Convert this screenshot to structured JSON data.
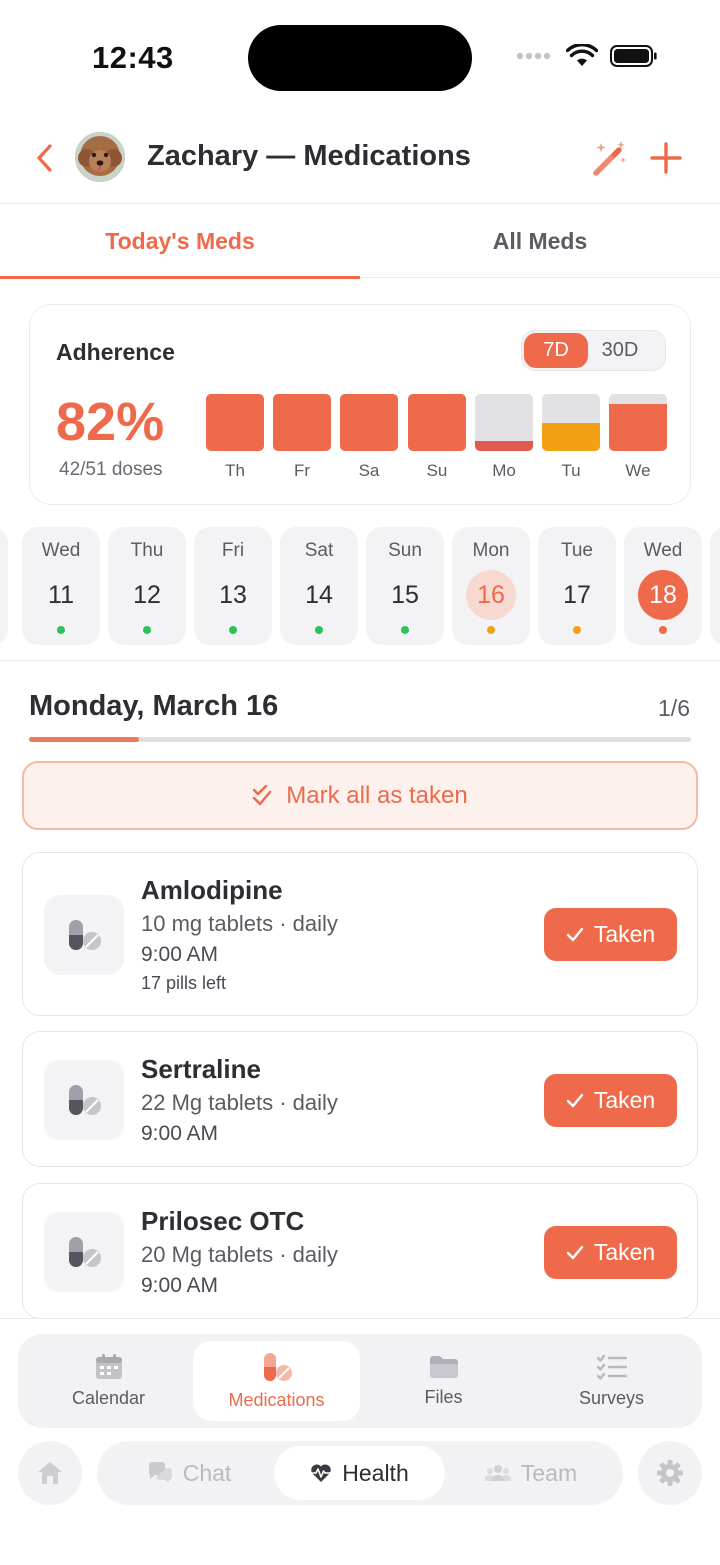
{
  "status_bar": {
    "time": "12:43"
  },
  "header": {
    "title": "Zachary — Medications"
  },
  "tabs": [
    {
      "label": "Today's Meds",
      "active": true
    },
    {
      "label": "All Meds",
      "active": false
    }
  ],
  "adherence": {
    "title": "Adherence",
    "ranges": [
      {
        "label": "7D",
        "active": true
      },
      {
        "label": "30D",
        "active": false
      }
    ],
    "percent": "82%",
    "doses": "42/51 doses",
    "days": [
      {
        "label": "Th",
        "fill": 1.0,
        "color": "#ee6a4a"
      },
      {
        "label": "Fr",
        "fill": 1.0,
        "color": "#ee6a4a"
      },
      {
        "label": "Sa",
        "fill": 1.0,
        "color": "#ee6a4a"
      },
      {
        "label": "Su",
        "fill": 1.0,
        "color": "#ee6a4a"
      },
      {
        "label": "Mo",
        "fill": 0.17,
        "color": "#e05a4e"
      },
      {
        "label": "Tu",
        "fill": 0.5,
        "color": "#f2a114"
      },
      {
        "label": "We",
        "fill": 0.83,
        "color": "#ee6a4a"
      }
    ]
  },
  "calendar_strip": {
    "days": [
      {
        "weekday": "Wed",
        "date": "11",
        "dot": "#2fbf5b",
        "state": "normal"
      },
      {
        "weekday": "Thu",
        "date": "12",
        "dot": "#2fbf5b",
        "state": "normal"
      },
      {
        "weekday": "Fri",
        "date": "13",
        "dot": "#2fbf5b",
        "state": "normal"
      },
      {
        "weekday": "Sat",
        "date": "14",
        "dot": "#2fbf5b",
        "state": "normal"
      },
      {
        "weekday": "Sun",
        "date": "15",
        "dot": "#2fbf5b",
        "state": "normal"
      },
      {
        "weekday": "Mon",
        "date": "16",
        "dot": "#f2a114",
        "state": "selected"
      },
      {
        "weekday": "Tue",
        "date": "17",
        "dot": "#f2a114",
        "state": "normal"
      },
      {
        "weekday": "Wed",
        "date": "18",
        "dot": "#ee6a4a",
        "state": "today"
      }
    ]
  },
  "day_detail": {
    "heading": "Monday, March 16",
    "count": "1/6",
    "progress": 0.1667,
    "mark_all_label": "Mark all as taken"
  },
  "medications": [
    {
      "name": "Amlodipine",
      "dose": "10 mg tablets · daily",
      "time": "9:00 AM",
      "pills_left": "17 pills left",
      "button": "Taken"
    },
    {
      "name": "Sertraline",
      "dose": "22 Mg tablets · daily",
      "time": "9:00 AM",
      "pills_left": "",
      "button": "Taken"
    },
    {
      "name": "Prilosec OTC",
      "dose": "20 Mg tablets · daily",
      "time": "9:00 AM",
      "pills_left": "",
      "button": "Taken"
    }
  ],
  "sub_nav": [
    {
      "label": "Calendar",
      "icon": "calendar-icon",
      "active": false
    },
    {
      "label": "Medications",
      "icon": "pills-icon",
      "active": true
    },
    {
      "label": "Files",
      "icon": "folder-icon",
      "active": false
    },
    {
      "label": "Surveys",
      "icon": "checklist-icon",
      "active": false
    }
  ],
  "main_nav": [
    {
      "label": "Chat",
      "icon": "chat-icon",
      "active": false
    },
    {
      "label": "Health",
      "icon": "heart-pulse-icon",
      "active": true
    },
    {
      "label": "Team",
      "icon": "team-icon",
      "active": false
    }
  ],
  "colors": {
    "accent": "#ee6a4a",
    "green": "#2fbf5b",
    "amber": "#f2a114"
  }
}
